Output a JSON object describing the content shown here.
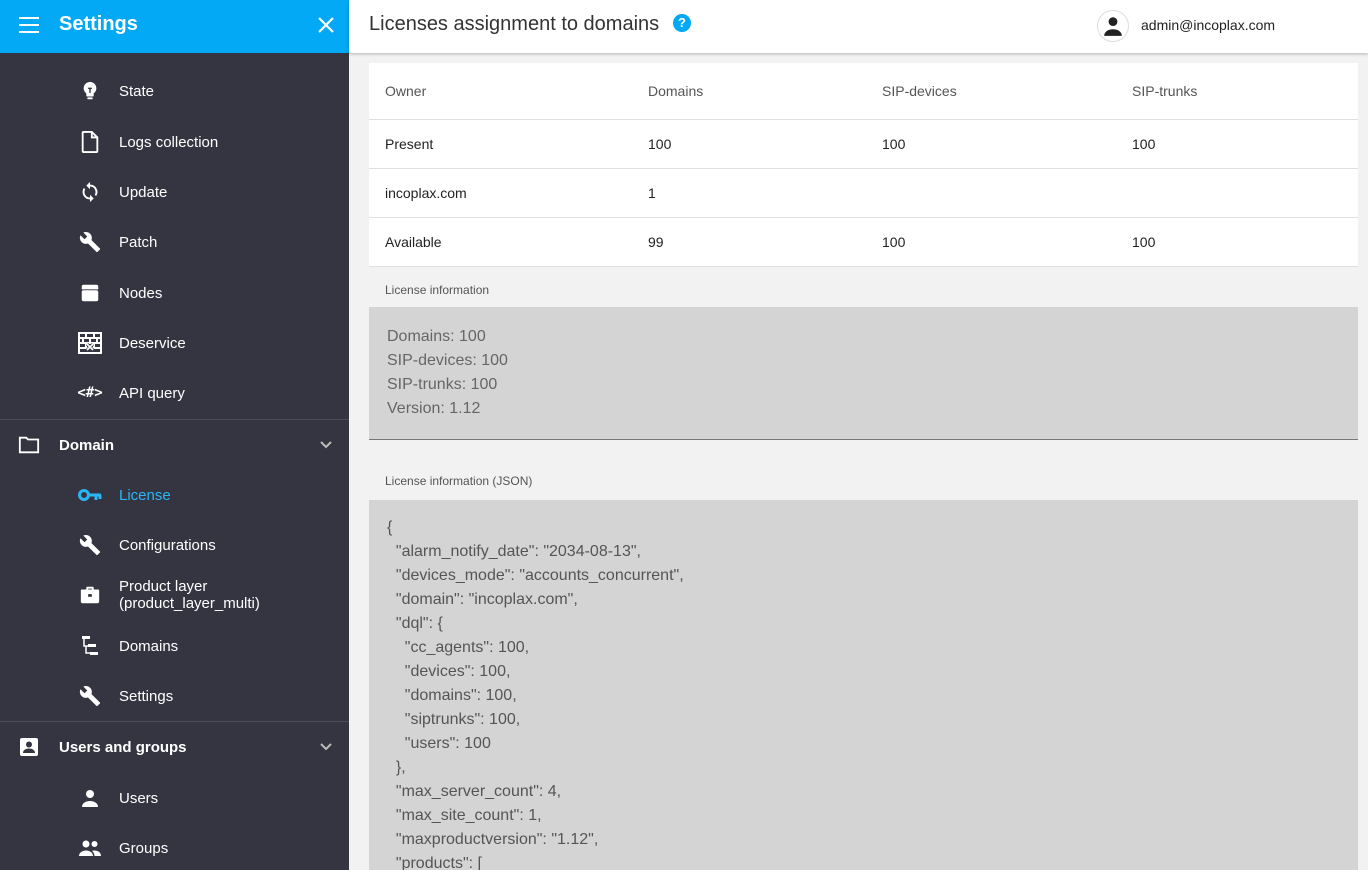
{
  "sidebar": {
    "title": "Settings",
    "items_top": [
      {
        "label": "State",
        "icon": "lightbulb-icon"
      },
      {
        "label": "Logs collection",
        "icon": "file-icon"
      },
      {
        "label": "Update",
        "icon": "sync-icon"
      },
      {
        "label": "Patch",
        "icon": "wrench-icon"
      },
      {
        "label": "Nodes",
        "icon": "storage-icon"
      },
      {
        "label": "Deservice",
        "icon": "firewall-icon"
      },
      {
        "label": "API query",
        "icon": "code-icon"
      }
    ],
    "group_domain": {
      "label": "Domain",
      "icon": "folder-icon"
    },
    "items_domain": [
      {
        "label": "License",
        "icon": "key-icon"
      },
      {
        "label": "Configurations",
        "icon": "wrench-icon"
      },
      {
        "label": "Product layer (product_layer_multi)",
        "icon": "briefcase-icon"
      },
      {
        "label": "Domains",
        "icon": "tree-icon"
      },
      {
        "label": "Settings",
        "icon": "wrench-icon"
      }
    ],
    "group_users": {
      "label": "Users and groups",
      "icon": "contact-icon"
    },
    "items_users": [
      {
        "label": "Users",
        "icon": "person-icon"
      },
      {
        "label": "Groups",
        "icon": "people-icon"
      }
    ],
    "accent_color": "#03a9f4",
    "bg_color": "#353541"
  },
  "header": {
    "title": "Licenses assignment to domains",
    "user": "admin@incoplax.com"
  },
  "table": {
    "headers": [
      "Owner",
      "Domains",
      "SIP-devices",
      "SIP-trunks"
    ],
    "rows": [
      [
        "Present",
        "100",
        "100",
        "100"
      ],
      [
        "incoplax.com",
        "1",
        "",
        ""
      ],
      [
        "Available",
        "99",
        "100",
        "100"
      ]
    ]
  },
  "license_info": {
    "label": "License information",
    "lines": [
      "Domains: 100",
      "SIP-devices: 100",
      "SIP-trunks: 100",
      "Version: 1.12"
    ]
  },
  "license_json": {
    "label": "License information (JSON)",
    "text": "{\n  \"alarm_notify_date\": \"2034-08-13\",\n  \"devices_mode\": \"accounts_concurrent\",\n  \"domain\": \"incoplax.com\",\n  \"dql\": {\n    \"cc_agents\": 100,\n    \"devices\": 100,\n    \"domains\": 100,\n    \"siptrunks\": 100,\n    \"users\": 100\n  },\n  \"max_server_count\": 4,\n  \"max_site_count\": 1,\n  \"maxproductversion\": \"1.12\",\n  \"products\": ["
  }
}
